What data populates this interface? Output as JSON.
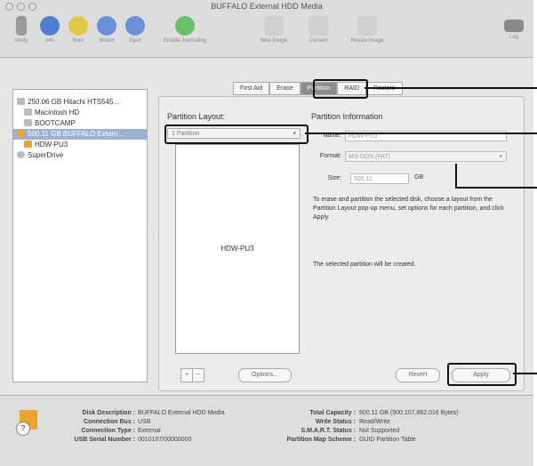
{
  "window": {
    "title": "BUFFALO External HDD Media"
  },
  "toolbar": {
    "items": [
      "Verify",
      "Info",
      "Burn",
      "Mount",
      "Eject",
      "Enable Journaling",
      "New Image",
      "Convert",
      "Resize Image"
    ],
    "log_label": "Log"
  },
  "sidebar": {
    "items": [
      "250.06 GB Hitachi HTS545...",
      "Macintosh HD",
      "BOOTCAMP",
      "500.11 GB BUFFALO Extern...",
      "HDW-PU3",
      "SuperDrive"
    ]
  },
  "tabs": [
    "First Aid",
    "Erase",
    "Partition",
    "RAID",
    "Restore"
  ],
  "partition": {
    "layout_label": "Partition Layout:",
    "layout_value": "1 Partition",
    "info_label": "Partition Information",
    "name_label": "Name:",
    "name_value": "HDW-PU3",
    "format_label": "Format:",
    "format_value": "MS-DOS (FAT)",
    "size_label": "Size:",
    "size_value": "500.11",
    "size_unit": "GB",
    "diagram_label": "HDW-PU3",
    "description": "To erase and partition the selected disk, choose a layout from the Partition Layout pop-up menu, set options for each partition, and click Apply.",
    "status": "The selected partition will be created.",
    "add_label": "+",
    "remove_label": "−",
    "options_label": "Options...",
    "revert_label": "Revert",
    "apply_label": "Apply"
  },
  "disk_info": {
    "left": [
      {
        "key": "Disk Description :",
        "value": "BUFFALO External HDD Media"
      },
      {
        "key": "Connection Bus :",
        "value": "USB"
      },
      {
        "key": "Connection Type :",
        "value": "External"
      },
      {
        "key": "USB Serial Number :",
        "value": "0010107/00000000"
      }
    ],
    "right": [
      {
        "key": "Total Capacity :",
        "value": "500.11 GB (500,107,862,016 Bytes)"
      },
      {
        "key": "Write Status :",
        "value": "Read/Write"
      },
      {
        "key": "S.M.A.R.T. Status :",
        "value": "Not Supported"
      },
      {
        "key": "Partition Map Scheme :",
        "value": "GUID Partition Table"
      }
    ]
  },
  "help_label": "?"
}
